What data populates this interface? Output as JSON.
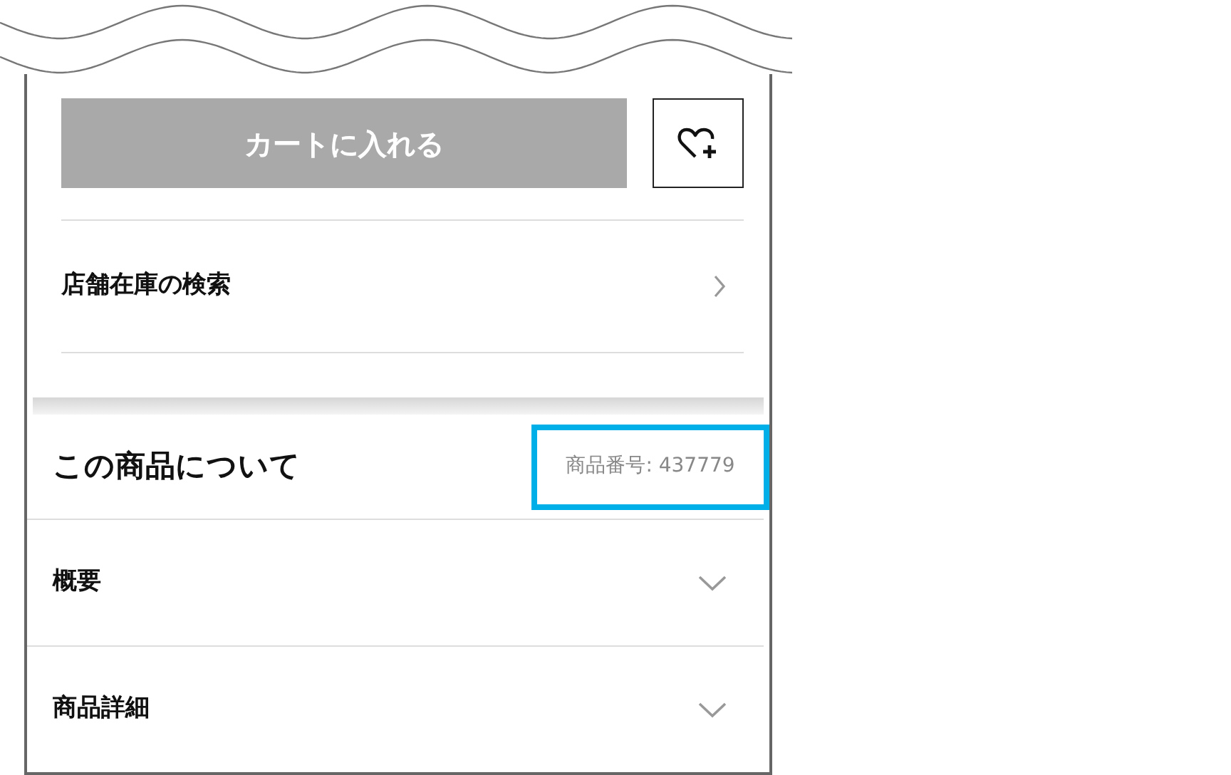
{
  "cart_button": {
    "label": "カートに入れる",
    "disabled": true
  },
  "store_stock": {
    "label": "店舗在庫の検索"
  },
  "section": {
    "title": "この商品について",
    "product_number": "商品番号: 437779",
    "highlighted": true
  },
  "accordions": [
    {
      "label": "概要",
      "expanded": false
    },
    {
      "label": "商品詳細",
      "expanded": false
    }
  ]
}
